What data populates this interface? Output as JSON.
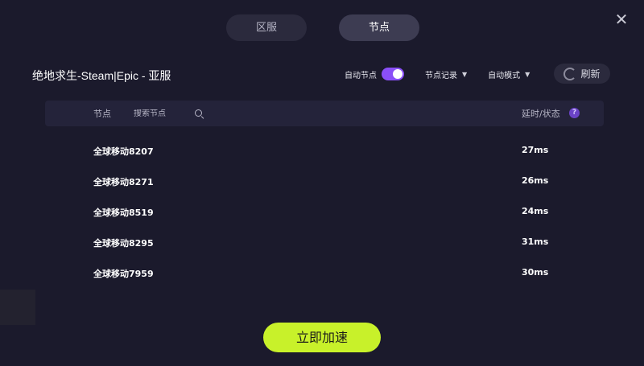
{
  "tabs": [
    {
      "label": "区服",
      "active": false
    },
    {
      "label": "节点",
      "active": true
    }
  ],
  "header": {
    "game_title": "绝地求生-Steam|Epic - 亚服",
    "auto_node_label": "自动节点",
    "auto_node_on": true,
    "node_history_label": "节点记录",
    "auto_mode_label": "自动模式",
    "refresh_label": "刷新"
  },
  "table": {
    "col_node": "节点",
    "search_placeholder": "搜索节点",
    "col_status": "延时/状态",
    "help_glyph": "?",
    "rows": [
      {
        "name": "全球移动8207",
        "latency": "27ms"
      },
      {
        "name": "全球移动8271",
        "latency": "26ms"
      },
      {
        "name": "全球移动8519",
        "latency": "24ms"
      },
      {
        "name": "全球移动8295",
        "latency": "31ms"
      },
      {
        "name": "全球移动7959",
        "latency": "30ms"
      }
    ]
  },
  "accelerate_label": "立即加速",
  "icons": {
    "close": "close-icon",
    "search": "search-icon",
    "caret": "caret-down-icon",
    "refresh": "refresh-icon"
  },
  "colors": {
    "accent": "#c8f12a",
    "toggle": "#8a4ff7",
    "background": "#1b1a2c"
  }
}
